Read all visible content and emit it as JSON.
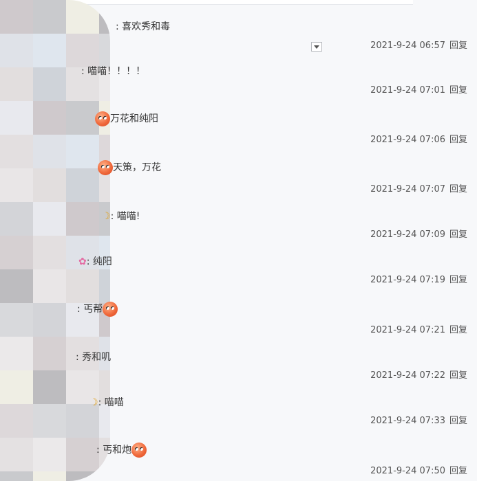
{
  "comments": [
    {
      "text": ": 喜欢秀和毒",
      "time": "2021-9-24 06:57",
      "reply": "回复"
    },
    {
      "text": ": 喵喵！！！！",
      "time": "2021-9-24 07:01",
      "reply": "回复"
    },
    {
      "text": "万花和纯阳",
      "time": "2021-9-24 07:06",
      "reply": "回复"
    },
    {
      "text": "天策，万花",
      "time": "2021-9-24 07:07",
      "reply": "回复"
    },
    {
      "text": ": 喵喵!",
      "time": "2021-9-24 07:09",
      "reply": "回复"
    },
    {
      "text": ": 纯阳",
      "time": "2021-9-24 07:19",
      "reply": "回复"
    },
    {
      "text": ": 丐帮",
      "time": "2021-9-24 07:21",
      "reply": "回复"
    },
    {
      "text": ": 秀和叽",
      "time": "2021-9-24 07:22",
      "reply": "回复"
    },
    {
      "text": ": 喵喵",
      "time": "2021-9-24 07:33",
      "reply": "回复"
    },
    {
      "text": ": 丐和炮",
      "time": "2021-9-24 07:50",
      "reply": "回复"
    }
  ],
  "colors": {
    "background": "#f7f8fa",
    "text": "#333333",
    "meta": "#555555"
  }
}
